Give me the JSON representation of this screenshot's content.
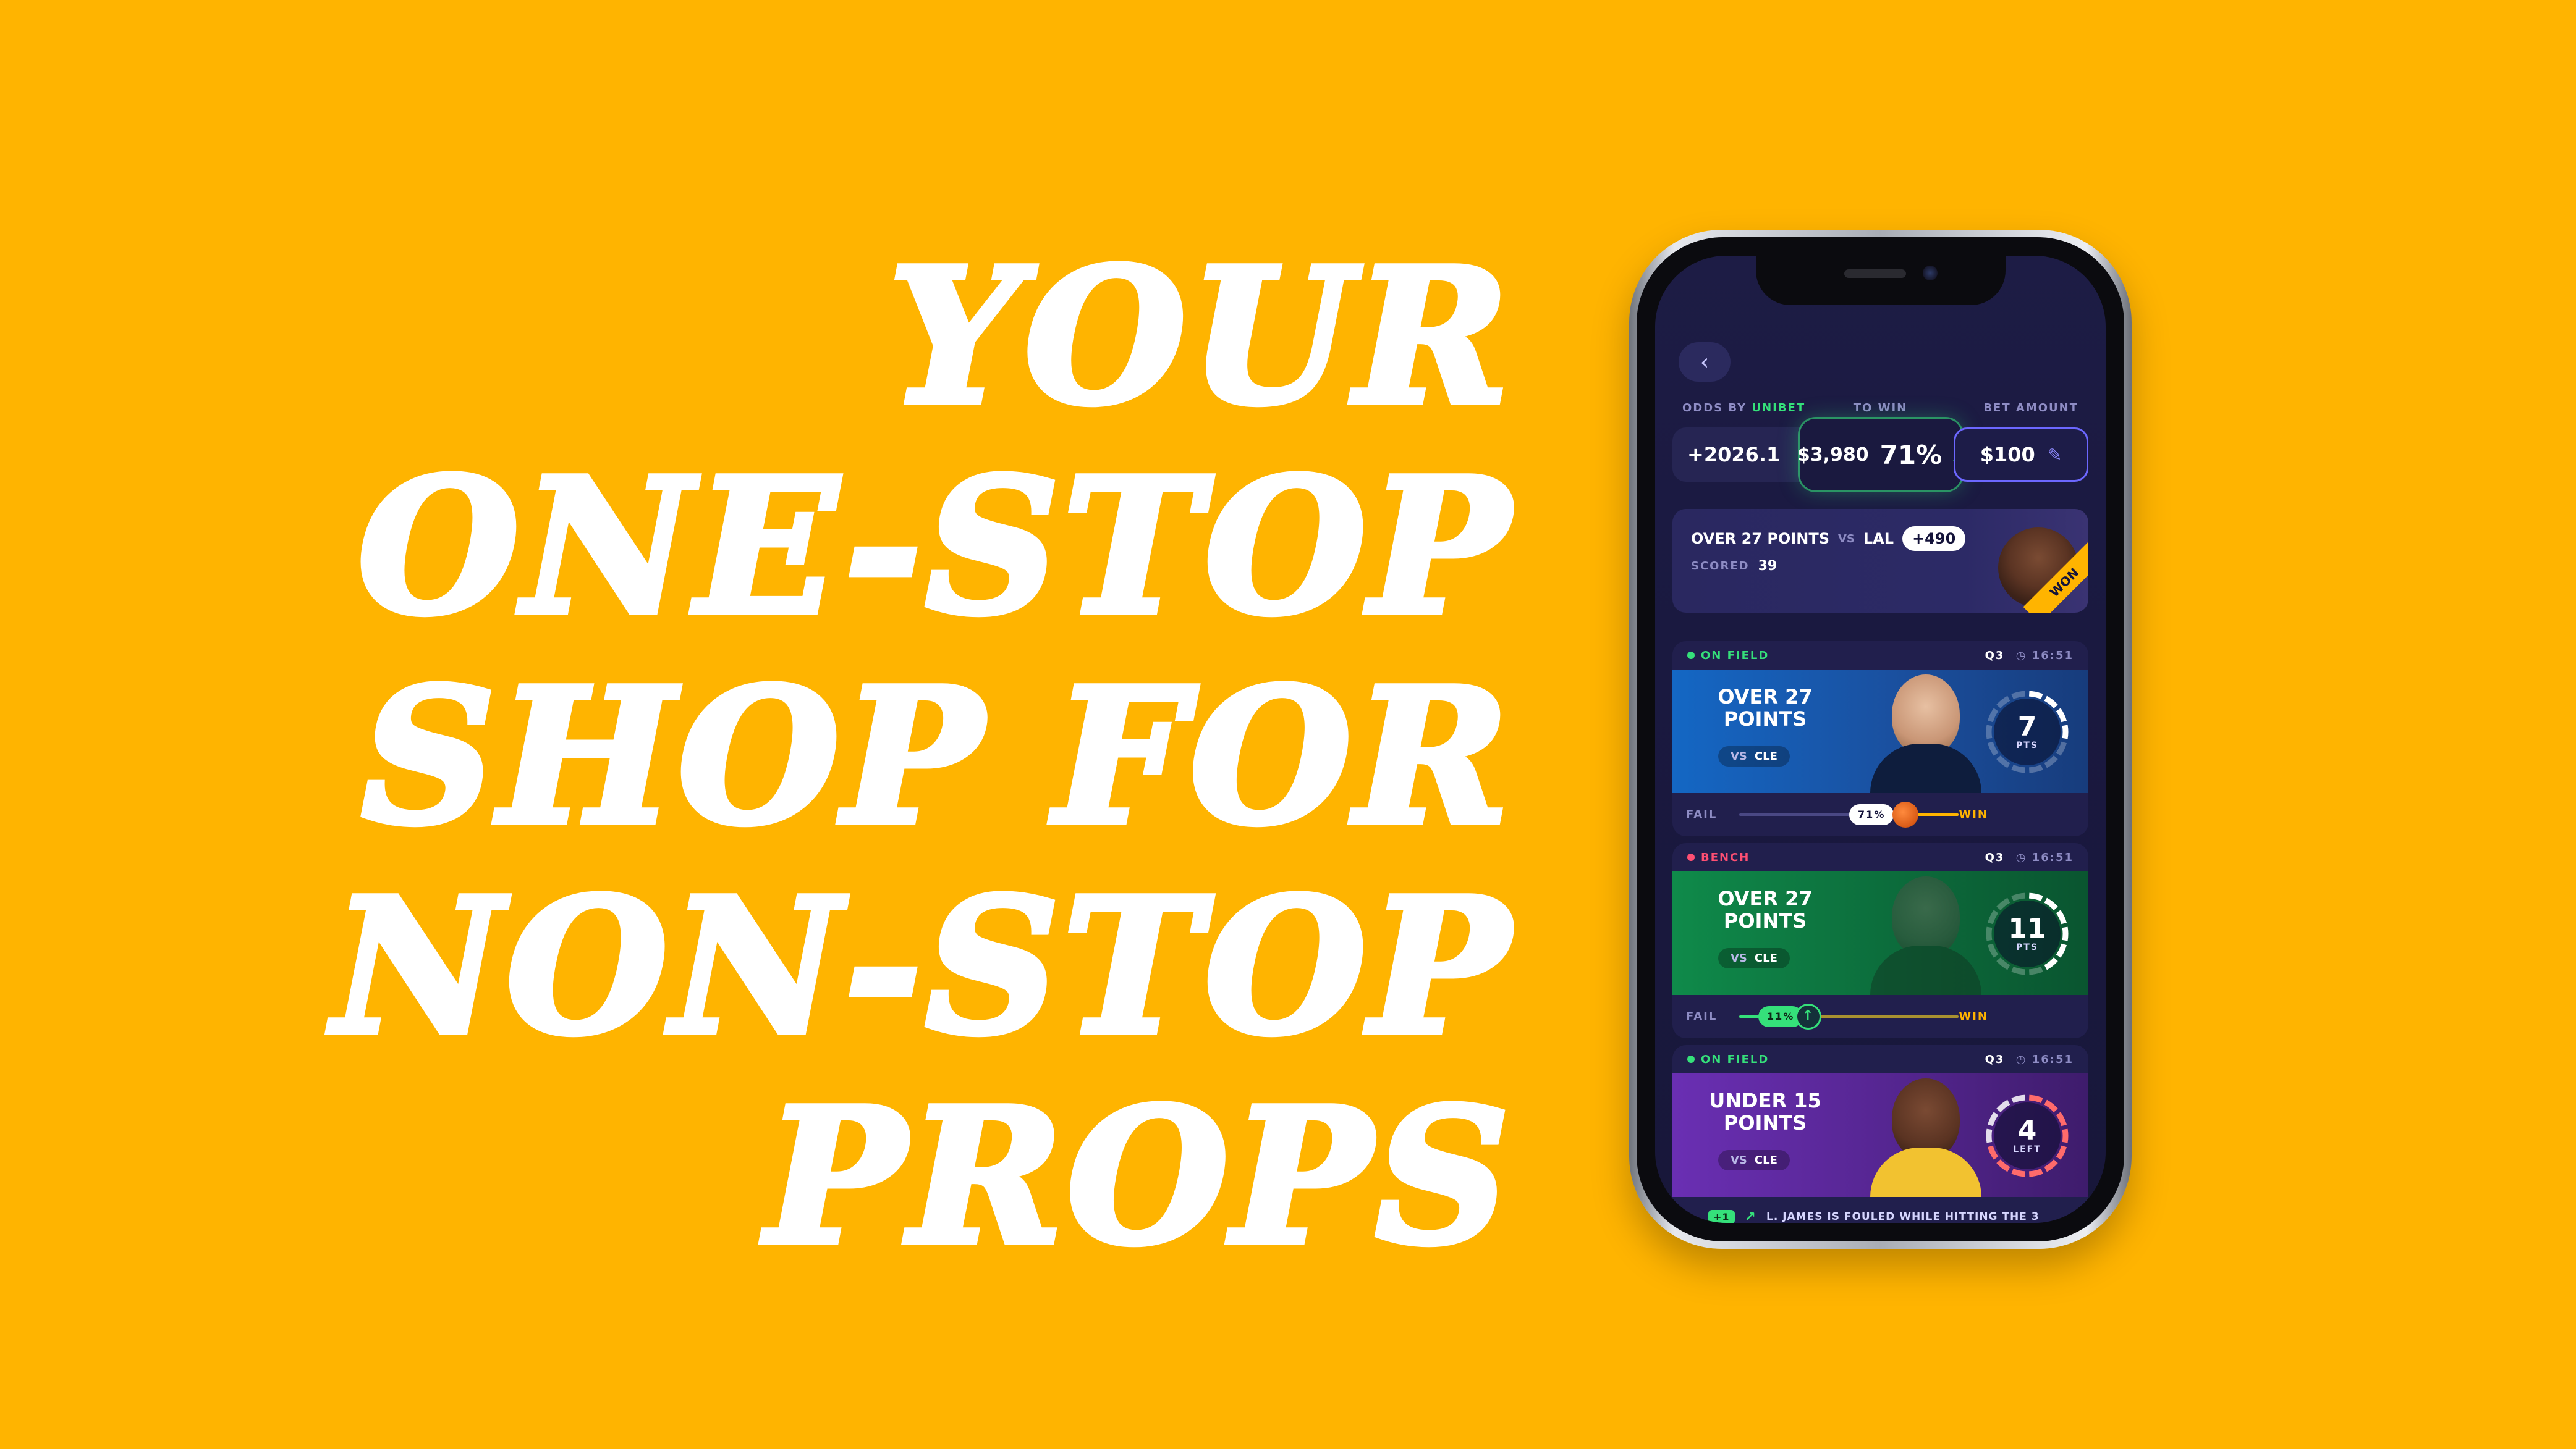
{
  "headline": {
    "lines": [
      "YOUR",
      "ONE-STOP",
      "SHOP FOR",
      "NON-STOP",
      "PROPS"
    ]
  },
  "colors": {
    "background": "#FFB400",
    "accent_green": "#35e07a",
    "accent_gold": "#FFB400",
    "accent_purple": "#6c67ff"
  },
  "app": {
    "back_icon": "chevron-left-icon",
    "odds_header": {
      "odds_label_prefix": "ODDS BY",
      "odds_brand": "UNIBET",
      "to_win_label": "TO WIN",
      "bet_amount_label": "BET AMOUNT",
      "odds_value": "+2026.1",
      "to_win_amount": "$3,980",
      "to_win_pct": "71%",
      "trend_icon": "arrow-up-icon",
      "bet_amount": "$100",
      "edit_icon": "pencil-icon"
    },
    "won_card": {
      "prop": "OVER 27 POINTS",
      "vs": "VS",
      "opponent": "LAL",
      "odds": "+490",
      "scored_label": "SCORED",
      "scored_value": "39",
      "ribbon": "WON"
    },
    "props": [
      {
        "status": "ON FIELD",
        "status_color": "#35e07a",
        "period": "Q3",
        "clock_icon": "clock-icon",
        "time": "16:51",
        "title_line1": "OVER 27",
        "title_line2": "POINTS",
        "vs": "VS",
        "opponent": "CLE",
        "gauge_value": "7",
        "gauge_unit": "PTS",
        "gauge_progress": 0.26,
        "fail_label": "FAIL",
        "win_label": "WIN",
        "marker_pct": "71%",
        "marker_icon": "basketball-icon",
        "probability": 0.71
      },
      {
        "status": "BENCH",
        "status_color": "#ff4f73",
        "period": "Q3",
        "clock_icon": "clock-icon",
        "time": "16:51",
        "title_line1": "OVER 27",
        "title_line2": "POINTS",
        "vs": "VS",
        "opponent": "CLE",
        "gauge_value": "11",
        "gauge_unit": "PTS",
        "gauge_progress": 0.41,
        "fail_label": "FAIL",
        "win_label": "WIN",
        "marker_pct": "11%",
        "marker_icon": "arrow-up-icon",
        "probability": 0.11
      },
      {
        "status": "ON FIELD",
        "status_color": "#35e07a",
        "period": "Q3",
        "clock_icon": "clock-icon",
        "time": "16:51",
        "title_line1": "UNDER 15",
        "title_line2": "POINTS",
        "vs": "VS",
        "opponent": "CLE",
        "gauge_value": "4",
        "gauge_unit": "LEFT",
        "gauge_progress": 0.73,
        "feed_tag": "+1",
        "feed_icon": "trend-up-icon",
        "feed_text": "L. JAMES IS FOULED WHILE HITTING THE 3"
      }
    ]
  }
}
